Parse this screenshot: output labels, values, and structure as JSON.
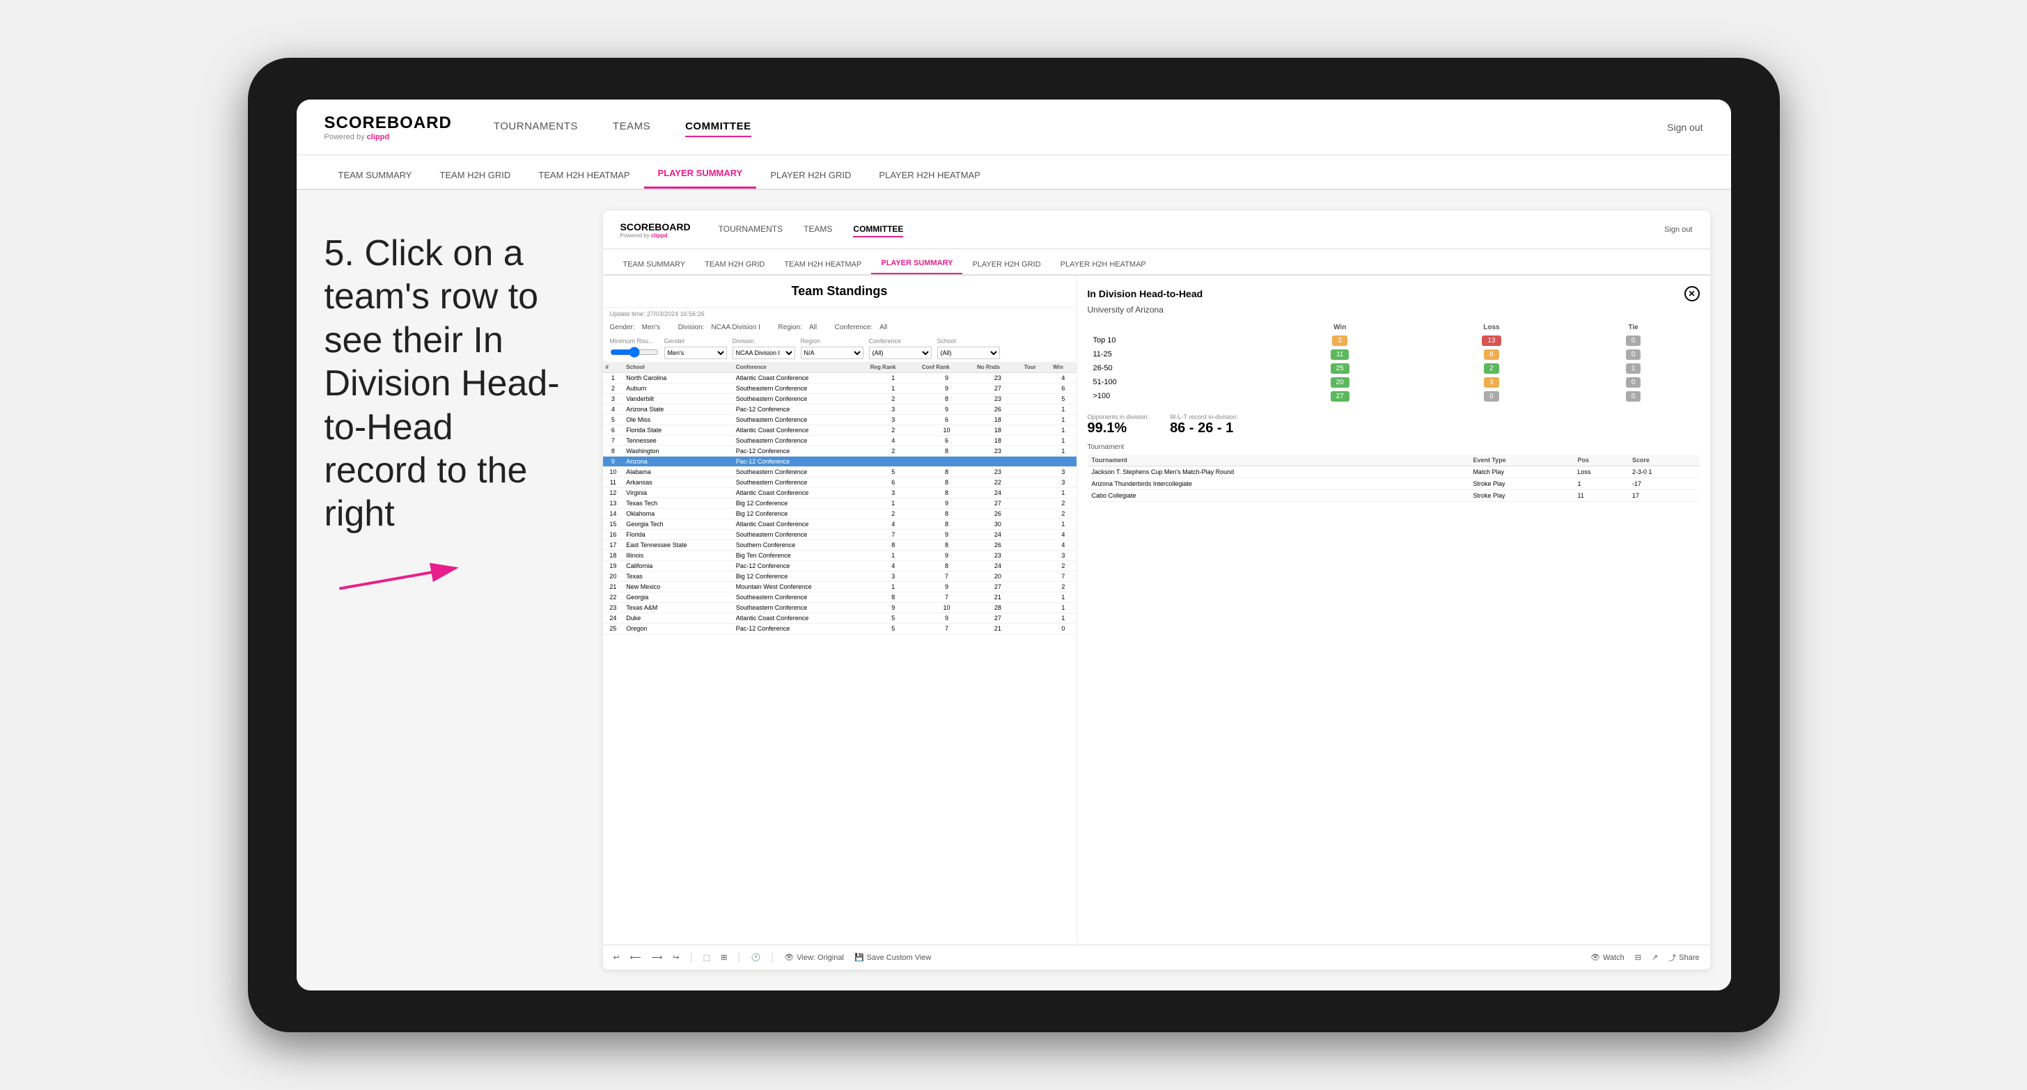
{
  "device": {
    "type": "tablet"
  },
  "instruction": {
    "step": "5.",
    "text": "Click on a team's row to see their In Division Head-to-Head record to the right"
  },
  "header": {
    "logo": "SCOREBOARD",
    "logo_sub": "Powered by",
    "logo_brand": "clippd",
    "nav": [
      "TOURNAMENTS",
      "TEAMS",
      "COMMITTEE"
    ],
    "active_nav": "COMMITTEE",
    "sign_out": "Sign out"
  },
  "sub_nav": {
    "items": [
      "TEAM SUMMARY",
      "TEAM H2H GRID",
      "TEAM H2H HEATMAP",
      "PLAYER SUMMARY",
      "PLAYER H2H GRID",
      "PLAYER H2H HEATMAP"
    ],
    "active": "PLAYER SUMMARY"
  },
  "app_inner": {
    "logo": "SCOREBOARD",
    "logo_sub": "Powered by",
    "logo_brand": "clippd",
    "nav": [
      "TOURNAMENTS",
      "TEAMS",
      "COMMITTEE"
    ],
    "active_nav": "COMMITTEE",
    "sign_out": "Sign out"
  },
  "app_sub_tabs": {
    "items": [
      "TEAM SUMMARY",
      "TEAM H2H GRID",
      "TEAM H2H HEATMAP",
      "PLAYER SUMMARY",
      "PLAYER H2H GRID",
      "PLAYER H2H HEATMAP"
    ],
    "active": "PLAYER SUMMARY"
  },
  "update_time": "Update time: 27/03/2024 16:56:26",
  "section_title": "Team Standings",
  "filters": {
    "gender_label": "Gender:",
    "gender_value": "Men's",
    "division_label": "Division:",
    "division_value": "NCAA Division I",
    "region_label": "Region:",
    "region_value": "All",
    "conference_label": "Conference:",
    "conference_value": "All",
    "min_rounds_label": "Minimum Rou...",
    "gender_select": "Men's",
    "division_select": "NCAA Division I",
    "region_select": "N/A",
    "conference_select": "(All)",
    "school_select": "(All)"
  },
  "table": {
    "headers": [
      "#",
      "School",
      "Conference",
      "Reg Rank",
      "Conf Rank",
      "No Rnds",
      "Tour",
      "Win"
    ],
    "rows": [
      {
        "num": 1,
        "school": "North Carolina",
        "conference": "Atlantic Coast Conference",
        "reg_rank": 1,
        "conf_rank": 9,
        "no_rnds": 23,
        "tour": "",
        "win": 4,
        "highlighted": false
      },
      {
        "num": 2,
        "school": "Auburn",
        "conference": "Southeastern Conference",
        "reg_rank": 1,
        "conf_rank": 9,
        "no_rnds": 27,
        "tour": "",
        "win": 6,
        "highlighted": false
      },
      {
        "num": 3,
        "school": "Vanderbilt",
        "conference": "Southeastern Conference",
        "reg_rank": 2,
        "conf_rank": 8,
        "no_rnds": 23,
        "tour": "",
        "win": 5,
        "highlighted": false
      },
      {
        "num": 4,
        "school": "Arizona State",
        "conference": "Pac-12 Conference",
        "reg_rank": 3,
        "conf_rank": 9,
        "no_rnds": 26,
        "tour": "",
        "win": 1,
        "highlighted": false
      },
      {
        "num": 5,
        "school": "Ole Miss",
        "conference": "Southeastern Conference",
        "reg_rank": 3,
        "conf_rank": 6,
        "no_rnds": 18,
        "tour": "",
        "win": 1,
        "highlighted": false
      },
      {
        "num": 6,
        "school": "Florida State",
        "conference": "Atlantic Coast Conference",
        "reg_rank": 2,
        "conf_rank": 10,
        "no_rnds": 18,
        "tour": "",
        "win": 1,
        "highlighted": false
      },
      {
        "num": 7,
        "school": "Tennessee",
        "conference": "Southeastern Conference",
        "reg_rank": 4,
        "conf_rank": 6,
        "no_rnds": 18,
        "tour": "",
        "win": 1,
        "highlighted": false
      },
      {
        "num": 8,
        "school": "Washington",
        "conference": "Pac-12 Conference",
        "reg_rank": 2,
        "conf_rank": 8,
        "no_rnds": 23,
        "tour": "",
        "win": 1,
        "highlighted": false
      },
      {
        "num": 9,
        "school": "Arizona",
        "conference": "Pac-12 Conference",
        "reg_rank": "",
        "conf_rank": "",
        "no_rnds": "",
        "tour": "",
        "win": "",
        "highlighted": true
      },
      {
        "num": 10,
        "school": "Alabama",
        "conference": "Southeastern Conference",
        "reg_rank": 5,
        "conf_rank": 8,
        "no_rnds": 23,
        "tour": "",
        "win": 3,
        "highlighted": false
      },
      {
        "num": 11,
        "school": "Arkansas",
        "conference": "Southeastern Conference",
        "reg_rank": 6,
        "conf_rank": 8,
        "no_rnds": 22,
        "tour": "",
        "win": 3,
        "highlighted": false
      },
      {
        "num": 12,
        "school": "Virginia",
        "conference": "Atlantic Coast Conference",
        "reg_rank": 3,
        "conf_rank": 8,
        "no_rnds": 24,
        "tour": "",
        "win": 1,
        "highlighted": false
      },
      {
        "num": 13,
        "school": "Texas Tech",
        "conference": "Big 12 Conference",
        "reg_rank": 1,
        "conf_rank": 9,
        "no_rnds": 27,
        "tour": "",
        "win": 2,
        "highlighted": false
      },
      {
        "num": 14,
        "school": "Oklahoma",
        "conference": "Big 12 Conference",
        "reg_rank": 2,
        "conf_rank": 8,
        "no_rnds": 26,
        "tour": "",
        "win": 2,
        "highlighted": false
      },
      {
        "num": 15,
        "school": "Georgia Tech",
        "conference": "Atlantic Coast Conference",
        "reg_rank": 4,
        "conf_rank": 8,
        "no_rnds": 30,
        "tour": "",
        "win": 1,
        "highlighted": false
      },
      {
        "num": 16,
        "school": "Florida",
        "conference": "Southeastern Conference",
        "reg_rank": 7,
        "conf_rank": 9,
        "no_rnds": 24,
        "tour": "",
        "win": 4,
        "highlighted": false
      },
      {
        "num": 17,
        "school": "East Tennessee State",
        "conference": "Southern Conference",
        "reg_rank": 8,
        "conf_rank": 8,
        "no_rnds": 26,
        "tour": "",
        "win": 4,
        "highlighted": false
      },
      {
        "num": 18,
        "school": "Illinois",
        "conference": "Big Ten Conference",
        "reg_rank": 1,
        "conf_rank": 9,
        "no_rnds": 23,
        "tour": "",
        "win": 3,
        "highlighted": false
      },
      {
        "num": 19,
        "school": "California",
        "conference": "Pac-12 Conference",
        "reg_rank": 4,
        "conf_rank": 8,
        "no_rnds": 24,
        "tour": "",
        "win": 2,
        "highlighted": false
      },
      {
        "num": 20,
        "school": "Texas",
        "conference": "Big 12 Conference",
        "reg_rank": 3,
        "conf_rank": 7,
        "no_rnds": 20,
        "tour": "",
        "win": 7,
        "highlighted": false
      },
      {
        "num": 21,
        "school": "New Mexico",
        "conference": "Mountain West Conference",
        "reg_rank": 1,
        "conf_rank": 9,
        "no_rnds": 27,
        "tour": "",
        "win": 2,
        "highlighted": false
      },
      {
        "num": 22,
        "school": "Georgia",
        "conference": "Southeastern Conference",
        "reg_rank": 8,
        "conf_rank": 7,
        "no_rnds": 21,
        "tour": "",
        "win": 1,
        "highlighted": false
      },
      {
        "num": 23,
        "school": "Texas A&M",
        "conference": "Southeastern Conference",
        "reg_rank": 9,
        "conf_rank": 10,
        "no_rnds": 28,
        "tour": "",
        "win": 1,
        "highlighted": false
      },
      {
        "num": 24,
        "school": "Duke",
        "conference": "Atlantic Coast Conference",
        "reg_rank": 5,
        "conf_rank": 9,
        "no_rnds": 27,
        "tour": "",
        "win": 1,
        "highlighted": false
      },
      {
        "num": 25,
        "school": "Oregon",
        "conference": "Pac-12 Conference",
        "reg_rank": 5,
        "conf_rank": 7,
        "no_rnds": 21,
        "tour": "",
        "win": 0,
        "highlighted": false
      }
    ]
  },
  "h2h": {
    "title": "In Division Head-to-Head",
    "school": "University of Arizona",
    "headers": [
      "",
      "Win",
      "Loss",
      "Tie"
    ],
    "rows": [
      {
        "label": "Top 10",
        "win": 3,
        "loss": 13,
        "tie": 0,
        "win_color": "yellow",
        "loss_color": "red"
      },
      {
        "label": "11-25",
        "win": 11,
        "loss": 8,
        "tie": 0,
        "win_color": "green",
        "loss_color": "yellow"
      },
      {
        "label": "26-50",
        "win": 25,
        "loss": 2,
        "tie": 1,
        "win_color": "green",
        "loss_color": "green"
      },
      {
        "label": "51-100",
        "win": 20,
        "loss": 3,
        "tie": 0,
        "win_color": "green",
        "loss_color": "yellow"
      },
      {
        "label": ">100",
        "win": 27,
        "loss": 0,
        "tie": 0,
        "win_color": "green",
        "loss_color": "gray"
      }
    ],
    "opponents_label": "Opponents in division:",
    "opponents_value": "99.1%",
    "wlt_label": "W-L-T record in-division:",
    "wlt_value": "86 - 26 - 1",
    "tournament_headers": [
      "Tournament",
      "Event Type",
      "Pos",
      "Score"
    ],
    "tournament_rows": [
      {
        "tournament": "Jackson T. Stephens Cup Men's Match-Play Round",
        "event_type": "Match Play",
        "pos": "Loss",
        "score": "2-3-0 1"
      },
      {
        "tournament": "Arizona Thunderbirds Intercollegiate",
        "event_type": "Stroke Play",
        "pos": "1",
        "score": "-17"
      },
      {
        "tournament": "Cabo Collegiate",
        "event_type": "Stroke Play",
        "pos": "11",
        "score": "17"
      }
    ]
  },
  "toolbar": {
    "undo": "↩",
    "redo": "↪",
    "view_original": "View: Original",
    "save_custom": "Save Custom View",
    "watch": "Watch",
    "share": "Share"
  }
}
